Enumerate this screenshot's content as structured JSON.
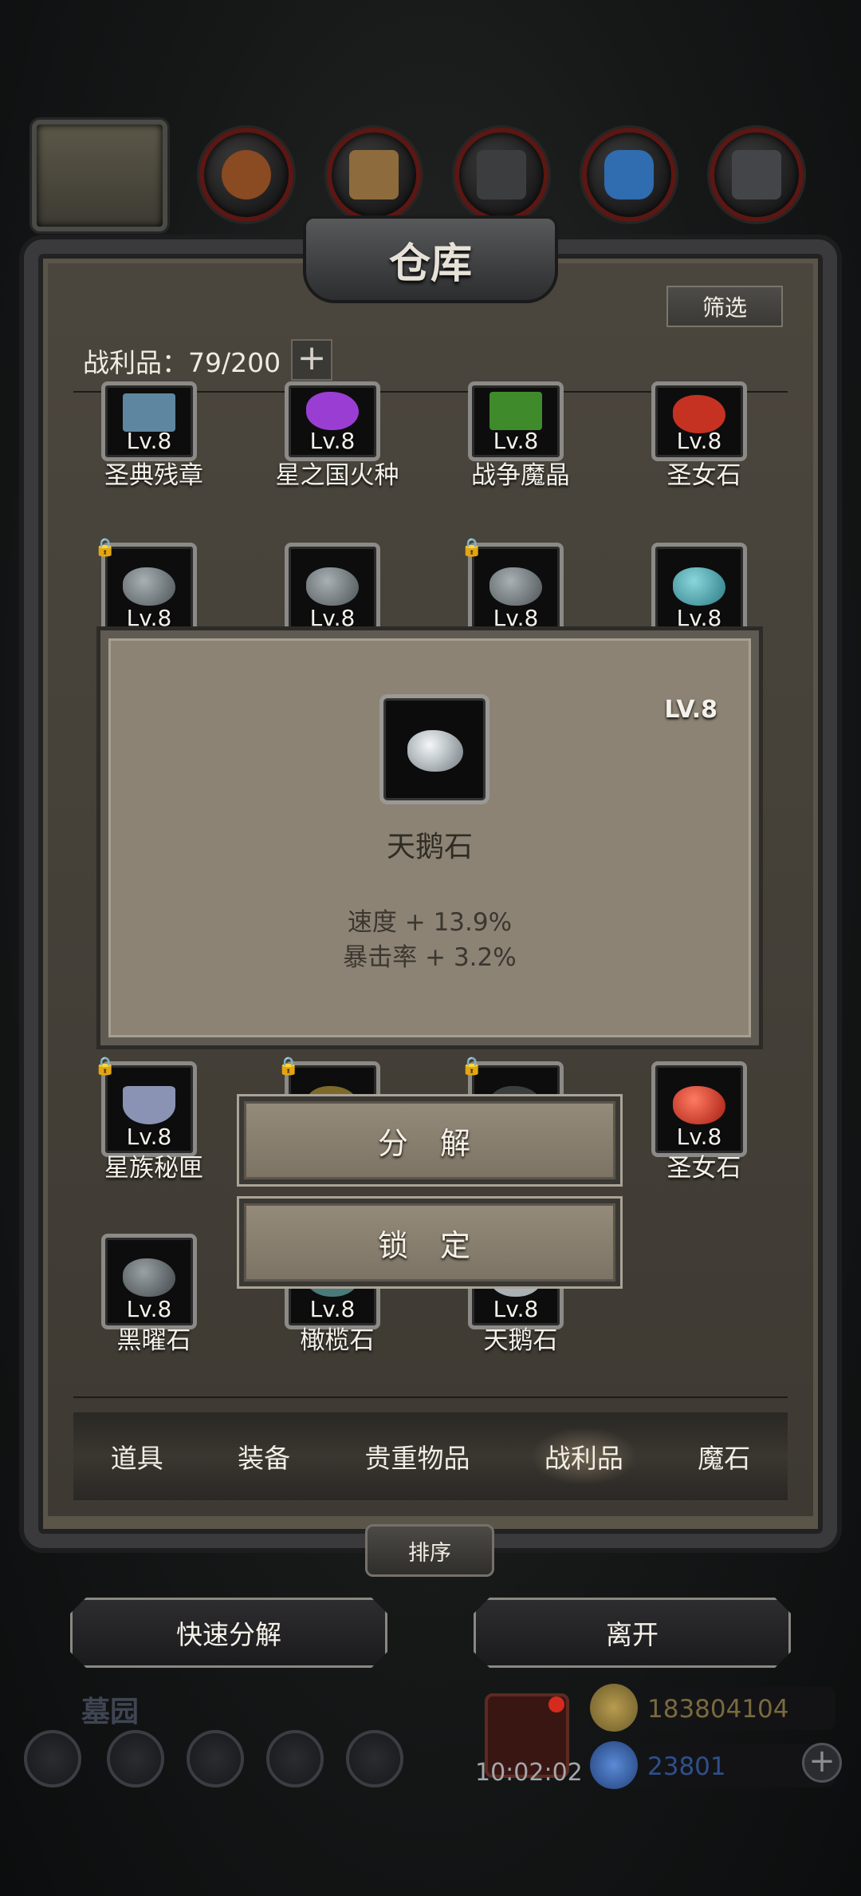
{
  "window": {
    "title": "仓库",
    "filter_label": "筛选"
  },
  "capacity": {
    "label": "战利品：79/200",
    "plus_symbol": "+"
  },
  "items": [
    {
      "name": "圣典残章",
      "level": "Lv.8",
      "locked": false,
      "icon": "book-icon",
      "color": "#5f86a0"
    },
    {
      "name": "星之国火种",
      "level": "Lv.8",
      "locked": false,
      "icon": "purple-crystal-icon",
      "color": "#9a3ed3"
    },
    {
      "name": "战争魔晶",
      "level": "Lv.8",
      "locked": false,
      "icon": "green-shard-icon",
      "color": "#3f8a2a"
    },
    {
      "name": "圣女石",
      "level": "Lv.8",
      "locked": false,
      "icon": "red-stone-icon",
      "color": "#c63222"
    },
    {
      "name": "",
      "level": "Lv.8",
      "locked": true,
      "icon": "gray-stone-icon",
      "color": "#6d7478"
    },
    {
      "name": "",
      "level": "Lv.8",
      "locked": false,
      "icon": "gray-stone-icon",
      "color": "#6d7478"
    },
    {
      "name": "",
      "level": "Lv.8",
      "locked": true,
      "icon": "gray-stone-icon",
      "color": "#6d7478"
    },
    {
      "name": "",
      "level": "Lv.8",
      "locked": false,
      "icon": "teal-stone-icon",
      "color": "#3b9aa3"
    },
    {
      "name": "星族秘匣",
      "level": "Lv.8",
      "locked": true,
      "icon": "star-box-icon",
      "color": "#8a93b4"
    },
    {
      "name": "",
      "level": "",
      "locked": true,
      "icon": "gold-relic-icon",
      "color": "#7d6a2a"
    },
    {
      "name": "",
      "level": "",
      "locked": true,
      "icon": "dark-orb-icon",
      "color": "#3a3f3e"
    },
    {
      "name": "圣女石",
      "level": "Lv.8",
      "locked": false,
      "icon": "red-stone-icon",
      "color": "#c63222"
    },
    {
      "name": "黑曜石",
      "level": "Lv.8",
      "locked": false,
      "icon": "obsidian-icon",
      "color": "#5a5f62"
    },
    {
      "name": "橄榄石",
      "level": "Lv.8",
      "locked": false,
      "icon": "olive-stone-icon",
      "color": "#4a7a7a"
    },
    {
      "name": "天鹅石",
      "level": "Lv.8",
      "locked": false,
      "icon": "swan-stone-icon",
      "color": "#aab1b5"
    }
  ],
  "tabs": [
    {
      "label": "道具",
      "active": false
    },
    {
      "label": "装备",
      "active": false
    },
    {
      "label": "贵重物品",
      "active": false
    },
    {
      "label": "战利品",
      "active": true
    },
    {
      "label": "魔石",
      "active": false
    }
  ],
  "sort_label": "排序",
  "quick_decompose_label": "快速分解",
  "leave_label": "离开",
  "popup": {
    "level": "LV.8",
    "name": "天鹅石",
    "stats": [
      "速度 + 13.9%",
      "暴击率 + 3.2%"
    ],
    "decompose_label": "分 解",
    "lock_label": "锁 定"
  },
  "hud": {
    "location": "墓园",
    "timer": "10:02:02",
    "gold": "183804104",
    "gems": "23801",
    "colors": {
      "gold": "#7a6a3e",
      "gems": "#2f4f8c"
    }
  }
}
